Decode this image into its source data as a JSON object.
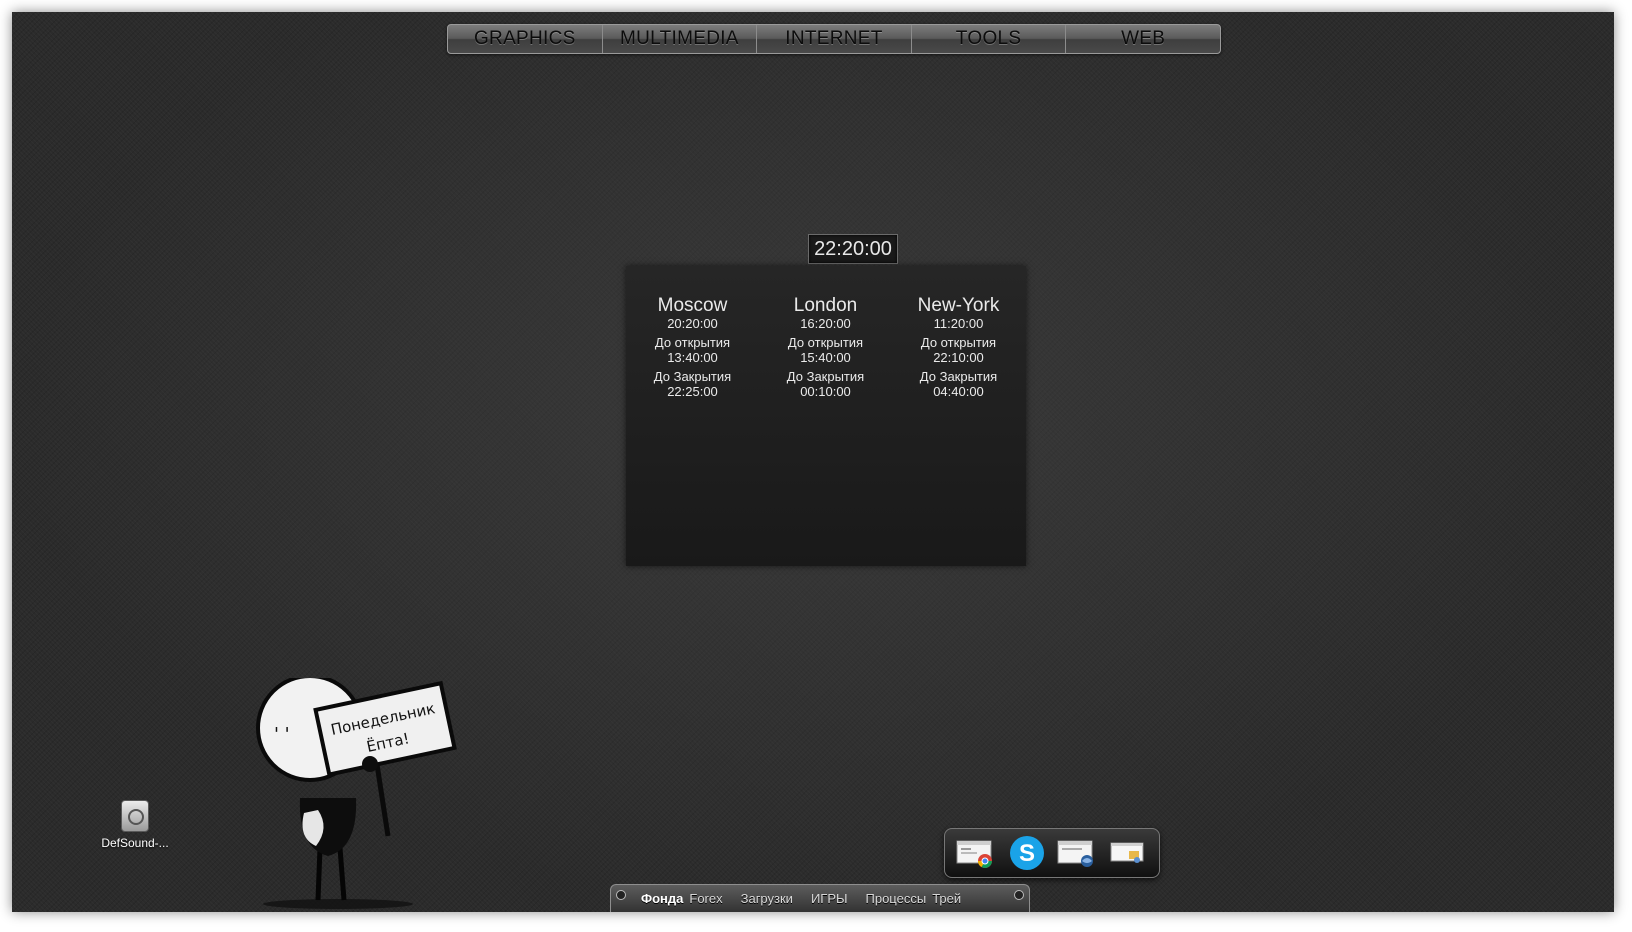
{
  "top_menu": [
    "GRAPHICS",
    "MULTIMEDIA",
    "INTERNET",
    "TOOLS",
    "WEB"
  ],
  "clock": "22:20:00",
  "markets": [
    {
      "city": "Moscow",
      "time": "20:20:00",
      "open_label": "До открытия",
      "open_value": "13:40:00",
      "close_label": "До Закрытия",
      "close_value": "22:25:00"
    },
    {
      "city": "London",
      "time": "16:20:00",
      "open_label": "До открытия",
      "open_value": "15:40:00",
      "close_label": "До Закрытия",
      "close_value": "00:10:00"
    },
    {
      "city": "New-York",
      "time": "11:20:00",
      "open_label": "До открытия",
      "open_value": "22:10:00",
      "close_label": "До Закрытия",
      "close_value": "04:40:00"
    }
  ],
  "desktop_icon": {
    "label": "DefSound-...",
    "icon": "speaker-file-icon"
  },
  "sign": {
    "line1": "Понедельник",
    "line2": "Ёпта!"
  },
  "dock_icons": [
    "chrome-window-icon",
    "skype-icon",
    "thunderbird-window-icon",
    "explorer-window-icon"
  ],
  "bottom_tabs": [
    {
      "label": "Фонда",
      "active": true
    },
    {
      "label": "Forex",
      "active": false
    },
    {
      "label": "Загрузки",
      "active": false
    },
    {
      "label": "ИГРЫ",
      "active": false
    },
    {
      "label": "Процессы",
      "active": false
    },
    {
      "label": "Трей",
      "active": false
    }
  ],
  "colors": {
    "accent_skype": "#1aa3e8",
    "chrome_red": "#db4437",
    "chrome_yellow": "#f4b400",
    "chrome_green": "#0f9d58"
  }
}
